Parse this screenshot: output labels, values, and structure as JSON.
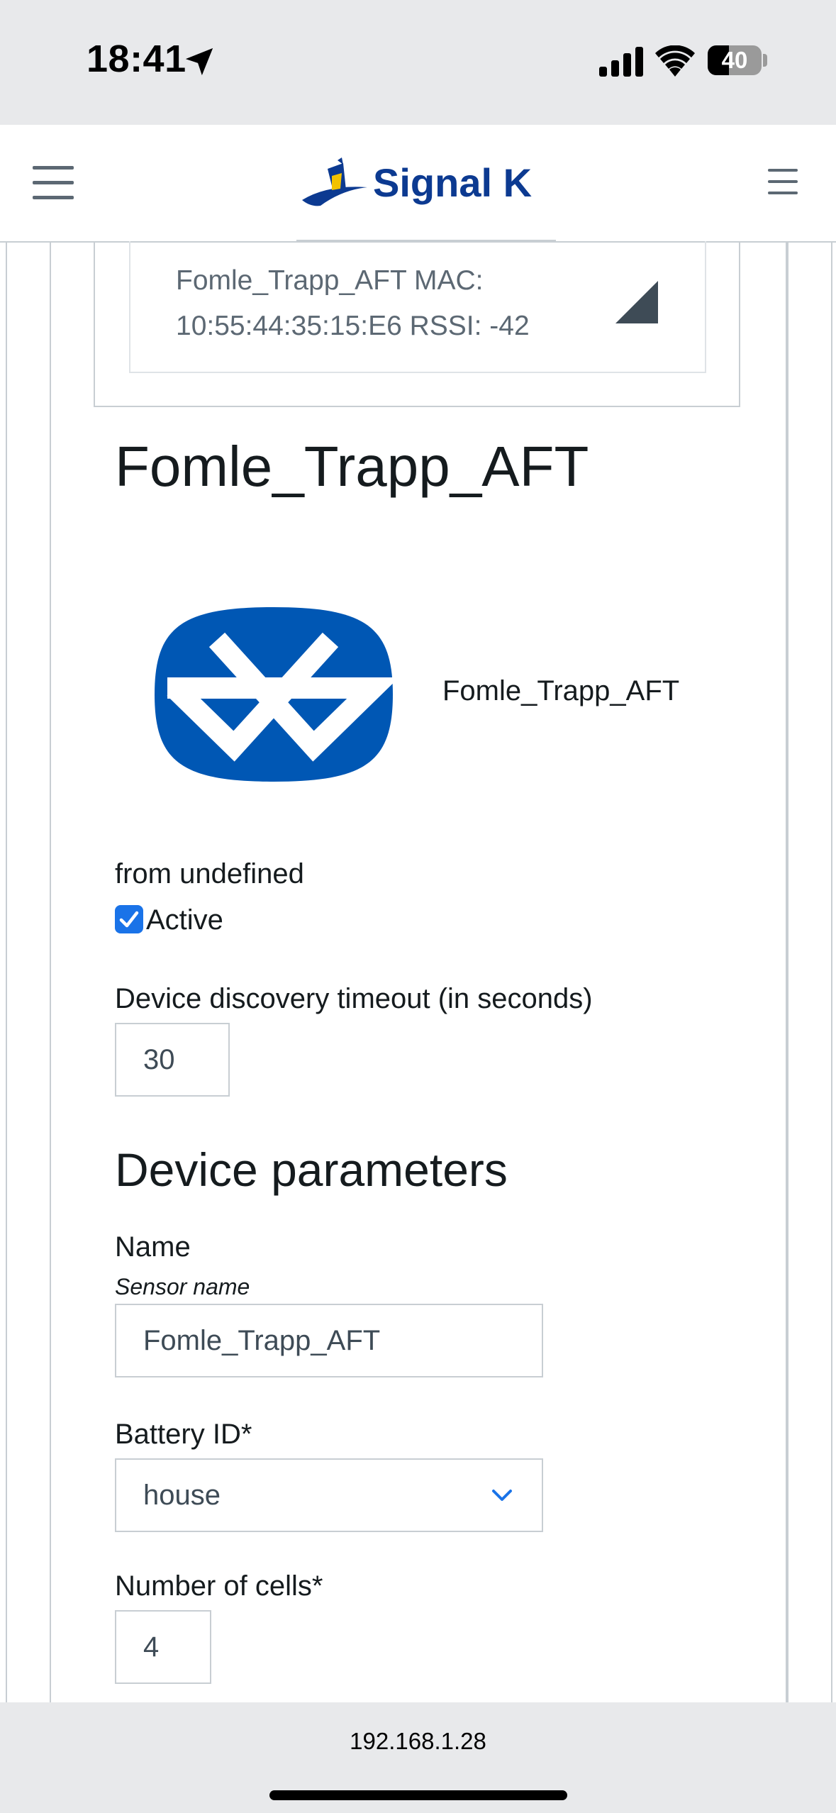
{
  "status_bar": {
    "time": "18:41",
    "battery_level": 40,
    "battery_text": "40",
    "icons": [
      "location-arrow-icon",
      "cellular-signal-icon",
      "wifi-icon",
      "battery-icon"
    ]
  },
  "header": {
    "brand": "Signal K",
    "menu_icon": "hamburger-menu-icon",
    "options_icon": "hamburger-menu-icon"
  },
  "device_list": {
    "selected_line1": "Fomle_Trapp_AFT MAC:",
    "selected_line2": "10:55:44:35:15:E6 RSSI: -42"
  },
  "device": {
    "title": "Fomle_Trapp_AFT",
    "icon": "bluetooth-icon",
    "icon_color": "#0057b4",
    "display_name": "Fomle_Trapp_AFT",
    "from_text": "from undefined",
    "active_label": "Active",
    "active_checked": true
  },
  "discovery": {
    "label": "Device discovery timeout (in seconds)",
    "value": "30"
  },
  "parameters": {
    "title": "Device parameters",
    "name_label": "Name",
    "name_hint": "Sensor name",
    "name_value": "Fomle_Trapp_AFT",
    "battery_label": "Battery ID*",
    "battery_value": "house",
    "cells_label": "Number of cells*",
    "cells_value": "4"
  },
  "url_bar": {
    "url": "192.168.1.28"
  },
  "colors": {
    "accent": "#1a73e8",
    "brand": "#0c3a91",
    "border": "#c8ced3"
  }
}
